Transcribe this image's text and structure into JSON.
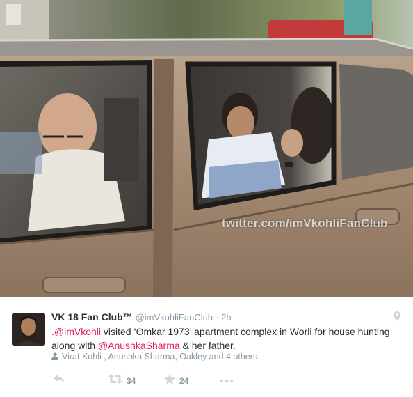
{
  "photo": {
    "description_icon": "car-photo-image",
    "watermark": "twitter.com/imVkohliFanClub"
  },
  "tweet": {
    "author_name": "VK 18 Fan Club™",
    "author_handle": "@imVkohliFanClub",
    "separator": "·",
    "time": "2h",
    "text_segments": {
      "mention1": ".@imVkohli",
      "text1": " visited ‘Omkar 1973’ apartment complex in Worli for house hunting along with ",
      "mention2": "@AnushkaSharma",
      "text2": " & her father."
    },
    "tagged_people": "Virat Kohli , Anushka Sharma, Oakley and 4 others",
    "actions": {
      "retweet_count": "34",
      "favorite_count": "24"
    },
    "colors": {
      "mention": "#e0245e",
      "meta": "#8899a6",
      "text": "#292f33"
    },
    "icons": [
      "location-pin-icon",
      "person-icon",
      "reply-icon",
      "retweet-icon",
      "star-icon",
      "more-icon"
    ]
  }
}
